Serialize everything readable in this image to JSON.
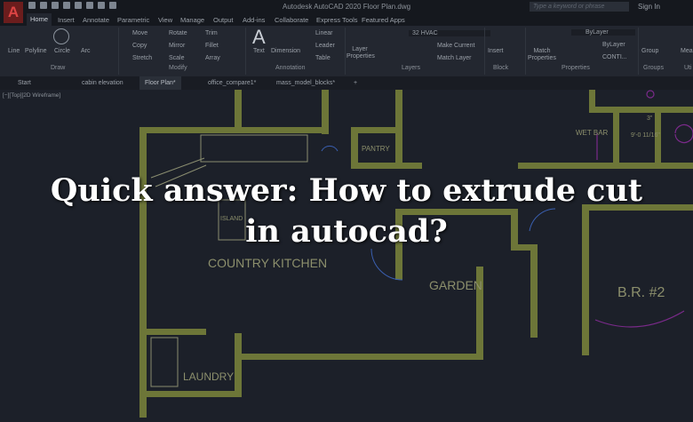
{
  "app": {
    "logo": "A",
    "title": "Autodesk AutoCAD 2020   Floor Plan.dwg",
    "search_placeholder": "Type a keyword or phrase",
    "sign_in": "Sign In"
  },
  "ribbon_tabs": [
    "Home",
    "Insert",
    "Annotate",
    "Parametric",
    "View",
    "Manage",
    "Output",
    "Add-ins",
    "Collaborate",
    "Express Tools",
    "Featured Apps"
  ],
  "draw": {
    "tools": [
      "Line",
      "Polyline",
      "Circle",
      "Arc"
    ],
    "group": "Draw"
  },
  "modify": {
    "tools": [
      "Move",
      "Rotate",
      "Trim",
      "Copy",
      "Mirror",
      "Fillet",
      "Stretch",
      "Scale",
      "Array"
    ],
    "group": "Modify"
  },
  "annotation": {
    "tools": [
      "Text",
      "Dimension",
      "Linear",
      "Leader",
      "Table"
    ],
    "group": "Annotation"
  },
  "layers": {
    "layer_properties": "Layer Properties",
    "current_layer": "32 HVAC",
    "make_current": "Make Current",
    "match_layer": "Match Layer",
    "group": "Layers"
  },
  "block": {
    "insert": "Insert",
    "group": "Block"
  },
  "properties": {
    "match": "Match Properties",
    "color": "ByLayer",
    "lineweight": "ByLayer",
    "linetype": "CONTI...",
    "group": "Properties"
  },
  "groups": {
    "group": "Group",
    "label": "Groups"
  },
  "utilities": {
    "measure": "Mea",
    "label": "Uti"
  },
  "doc_tabs": [
    "Start",
    "cabin elevation",
    "Floor Plan*",
    "office_compare1*",
    "mass_model_blocks*"
  ],
  "viewport_label": "[−][Top][2D Wireframe]",
  "rooms": [
    "PANTRY",
    "ISLAND",
    "COUNTRY KITCHEN",
    "GARDEN",
    "B.R. #2",
    "LAUNDRY",
    "WET BAR",
    "9'-0 11/16\"",
    "3\""
  ],
  "headline": [
    "Quick answer: How to extrude cut",
    "in autocad?"
  ],
  "colors": {
    "wall": "#6d7638",
    "accent": "#c0392b",
    "bg": "#1c2029"
  }
}
